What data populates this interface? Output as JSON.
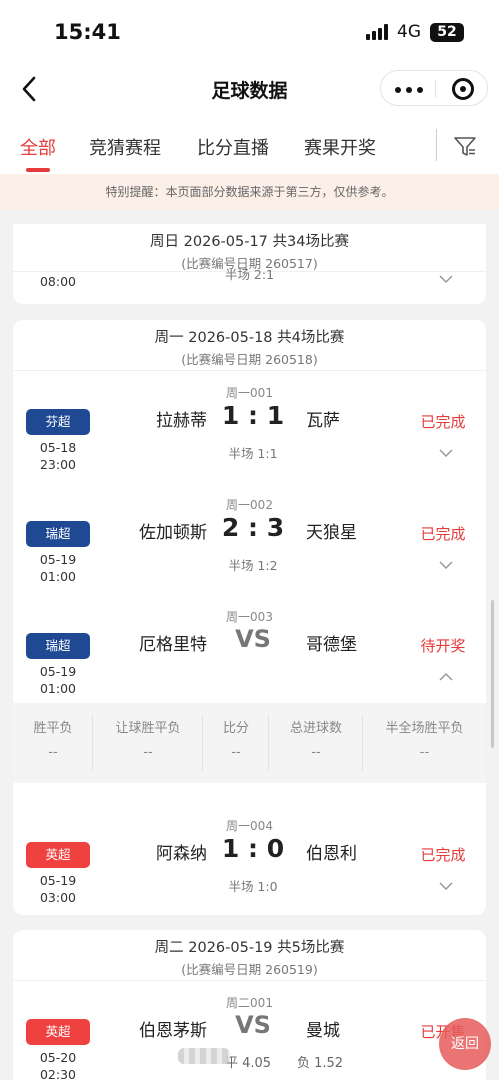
{
  "status_bar": {
    "time": "15:41",
    "network": "4G",
    "battery": "52"
  },
  "nav": {
    "title": "足球数据",
    "back_icon": "chevron-left-icon",
    "more_icon": "more-dots-icon",
    "target_icon": "target-icon"
  },
  "tabs": [
    {
      "label": "全部",
      "active": true
    },
    {
      "label": "竞猜赛程",
      "active": false
    },
    {
      "label": "比分直播",
      "active": false
    },
    {
      "label": "赛果开奖",
      "active": false
    }
  ],
  "filter_icon": "filter-icon",
  "notice": "特别提醒：本页面部分数据来源于第三方，仅供参考。",
  "colors": {
    "accent": "#e63b3b",
    "league_blue": "#1f4a93",
    "league_red": "#f04141",
    "notice_bg": "#fcefe8"
  },
  "day_sun": {
    "header": "周日 2026-05-17 共34场比赛",
    "subheader": "(比赛编号日期 260517)",
    "partial_half": "半场 2:1",
    "partial_time": "08:00"
  },
  "day_mon": {
    "header": "周一 2026-05-18 共4场比赛",
    "subheader": "(比赛编号日期 260518)",
    "matches": [
      {
        "code": "周一001",
        "league": "芬超",
        "date": "05-18",
        "time": "23:00",
        "home": "拉赫蒂",
        "score": "1 : 1",
        "away": "瓦萨",
        "half": "半场 1:1",
        "status": "已完成"
      },
      {
        "code": "周一002",
        "league": "瑞超",
        "date": "05-19",
        "time": "01:00",
        "home": "佐加顿斯",
        "score": "2 : 3",
        "away": "天狼星",
        "half": "半场 1:2",
        "status": "已完成"
      },
      {
        "code": "周一003",
        "league": "瑞超",
        "date": "05-19",
        "time": "01:00",
        "home": "厄格里特",
        "score": "VS",
        "away": "哥德堡",
        "half": "",
        "status": "待开奖"
      },
      {
        "code": "周一004",
        "league": "英超",
        "date": "05-19",
        "time": "03:00",
        "home": "阿森纳",
        "score": "1 : 0",
        "away": "伯恩利",
        "half": "半场 1:0",
        "status": "已完成"
      }
    ],
    "odds": [
      {
        "label": "胜平负",
        "value": "--"
      },
      {
        "label": "让球胜平负",
        "value": "--"
      },
      {
        "label": "比分",
        "value": "--"
      },
      {
        "label": "总进球数",
        "value": "--"
      },
      {
        "label": "半全场胜平负",
        "value": "--"
      }
    ]
  },
  "day_tue": {
    "header": "周二 2026-05-19 共5场比赛",
    "subheader": "(比赛编号日期 260519)",
    "match": {
      "code": "周二001",
      "league": "英超",
      "date": "05-20",
      "time": "02:30",
      "home": "伯恩茅斯",
      "score": "VS",
      "away": "曼城",
      "odds_draw": "平 4.05",
      "odds_away": "负 1.52",
      "status": "已开售"
    }
  },
  "return_label": "返回"
}
